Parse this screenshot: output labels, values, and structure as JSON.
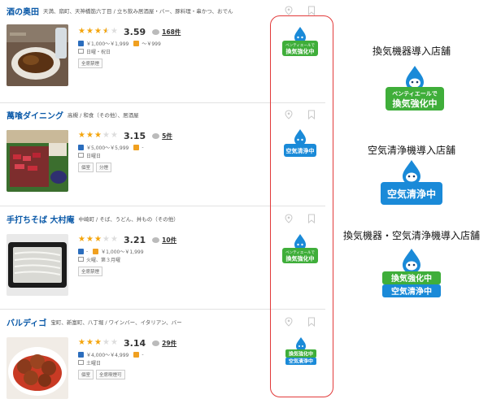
{
  "restaurants": [
    {
      "name": "酒の奥田",
      "genre": "天満、扇町、天神橋筋六丁目 / 立ち飲み居酒屋・バー、豚料理・串かつ、おでん",
      "rating": 3.59,
      "stars": 3.5,
      "reviews": "168件",
      "dinner_price": "￥1,000～￥1,999",
      "lunch_price": "～￥999",
      "closed": "日曜・祝日",
      "tags": [
        "全席禁煙"
      ],
      "badge": "ventilation",
      "thumb": "fish"
    },
    {
      "name": "萬喰ダイニング",
      "genre": "高槻 / 和食（その他）、居酒屋",
      "rating": 3.15,
      "stars": 3,
      "reviews": "5件",
      "dinner_price": "￥5,000～￥5,999",
      "lunch_price": "-",
      "closed": "日曜日",
      "tags": [
        "個室",
        "分煙"
      ],
      "badge": "air",
      "thumb": "sashimi"
    },
    {
      "name": "手打ちそば 大村庵",
      "genre": "中崎町 / そば、うどん、丼もの（その他）",
      "rating": 3.21,
      "stars": 3,
      "reviews": "10件",
      "dinner_price": "-",
      "lunch_price": "￥1,000～￥1,999",
      "closed": "火曜、第３月曜",
      "tags": [
        "全席禁煙"
      ],
      "badge": "ventilation",
      "thumb": "soba"
    },
    {
      "name": "バルディゴ",
      "genre": "宝町、新富町、八丁堀 / ワインバー、イタリアン、バー",
      "rating": 3.14,
      "stars": 3,
      "reviews": "29件",
      "dinner_price": "￥4,000～￥4,999",
      "lunch_price": "-",
      "closed": "土曜日",
      "tags": [
        "個室",
        "全席喫煙可"
      ],
      "badge": "both",
      "thumb": "meatball"
    }
  ],
  "badges": {
    "ventilation_top": "ベンティエールで",
    "ventilation_main": "換気強化中",
    "air_main": "空気清浄中",
    "both_top": "換気強化中",
    "both_bottom": "空気清浄中"
  },
  "legend": {
    "ventilation_title": "換気機器導入店舗",
    "air_title": "空気清浄機導入店舗",
    "both_title": "換気機器・空気清浄機導入店舗"
  },
  "colors": {
    "green": "#3fae3a",
    "blue": "#1a8ad8",
    "highlight": "#e23a3a",
    "link": "#0a59a8",
    "star": "#f4a50d"
  }
}
